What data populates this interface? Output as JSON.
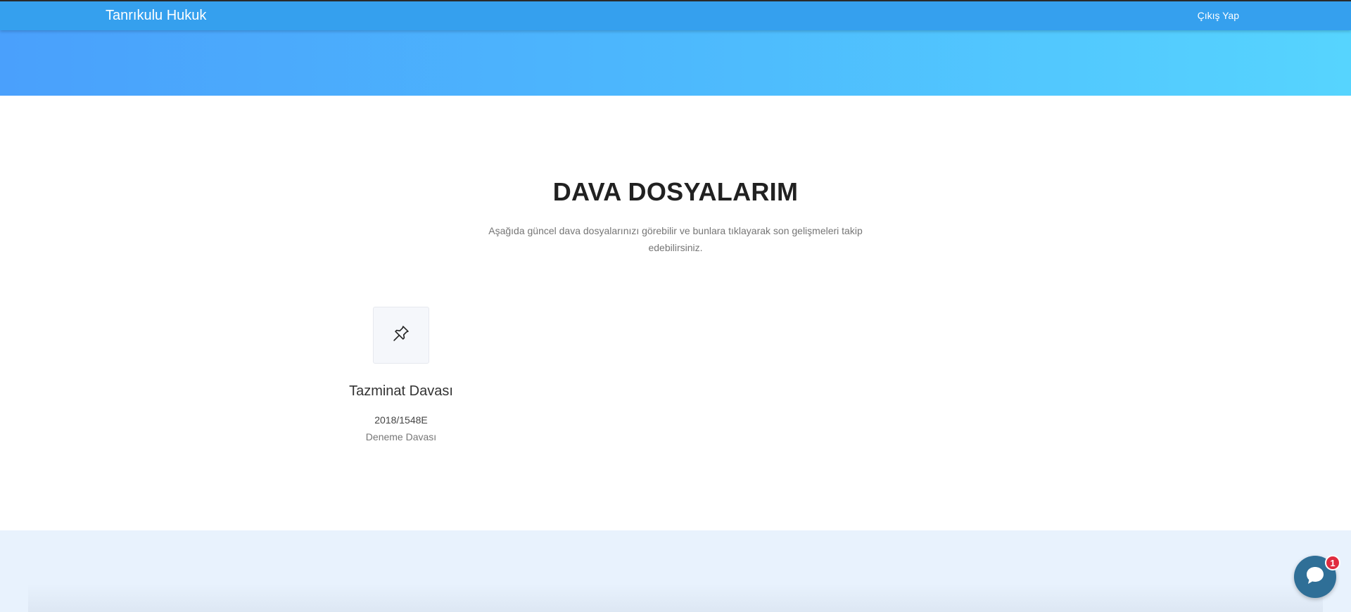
{
  "navbar": {
    "brand": "Tanrıkulu Hukuk",
    "logout": "Çıkış Yap"
  },
  "main": {
    "title": "DAVA DOSYALARIM",
    "description": "Aşağıda güncel dava dosyalarınızı görebilir ve bunlara tıklayarak son gelişmeleri takip edebilirsiniz."
  },
  "cases": [
    {
      "icon": "pushpin-icon",
      "title": "Tazminat Davası",
      "number": "2018/1548E",
      "description": "Deneme Davası"
    }
  ],
  "chat": {
    "icon": "chat-bubble-icon",
    "badge": "1"
  },
  "colors": {
    "navbar": "#35a0ee",
    "hero_start": "#4aa0fc",
    "hero_end": "#56d4fe",
    "footer_band": "#e8f2fd",
    "chat_button": "#2f6f97",
    "badge": "#e02c3f"
  }
}
